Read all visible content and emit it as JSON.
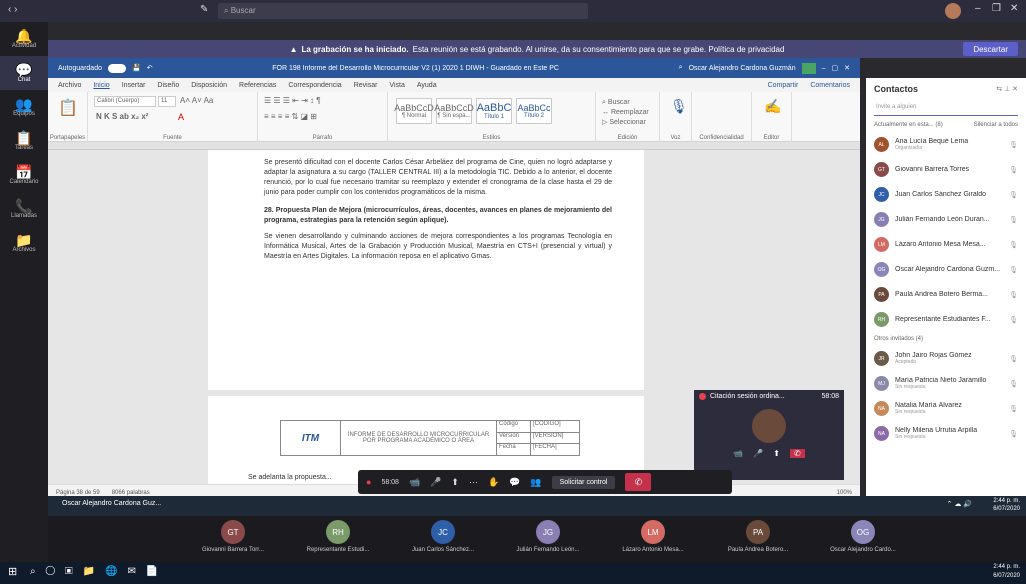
{
  "search_placeholder": "Buscar",
  "banner": {
    "bold": "La grabación se ha iniciado.",
    "text": "Esta reunión se está grabando. Al unirse, da su consentimiento para que se grabe. Política de privacidad",
    "discard": "Descartar"
  },
  "word": {
    "autosave": "Autoguardado",
    "title": "FOR 198 Informe del Desarrollo Microcurricular V2 (1) 2020 1 DIWH - Guardado en Este PC",
    "user": "Oscar Alejandro Cardona Guzmán",
    "tabs": [
      "Archivo",
      "Inicio",
      "Insertar",
      "Diseño",
      "Disposición",
      "Referencias",
      "Correspondencia",
      "Revisar",
      "Vista",
      "Ayuda"
    ],
    "share": "Compartir",
    "comments": "Comentarios",
    "groups": [
      "Portapapeles",
      "Fuente",
      "Párrafo",
      "Estilos",
      "Edición",
      "Voz",
      "Confidencialidad",
      "Editor"
    ],
    "font": "Calibri (Cuerpo)",
    "size": "11",
    "styles": [
      "¶ Normal",
      "¶ Sin espa...",
      "Título 1",
      "Título 2"
    ],
    "para1": "Se presentó dificultad con el docente Carlos César Arbeláez del programa de Cine, quien no logró adaptarse y adaptar la asignatura a su cargo (TALLER CENTRAL III) a la metodología TIC. Debido a lo anterior, el docente renunció, por lo cual fue necesario tramitar su reemplazo y extender el cronograma de la clase hasta el 29 de junio para poder cumplir con los contenidos programáticos de la misma.",
    "heading": "28. Propuesta Plan de Mejora (microcurrículos, áreas, docentes, avances en planes de mejoramiento del programa, estrategias para la retención según aplique).",
    "para2": "Se vienen desarrollando y culminando acciones de mejora correspondientes a los programas Tecnología en Informática Musical, Artes de la Grabación y Producción Musical, Maestría en CTS+I (presencial y virtual) y Maestría en Artes Digitales. La información reposa en el aplicativo Gmas.",
    "hdr_title": "INFORME DE DESARROLLO MICROCURRICULAR POR PROGRAMA ACADÉMICO O ÁREA",
    "hdr_logo": "ITM",
    "hdr_rows": [
      [
        "Código",
        "[CODIGO]"
      ],
      [
        "Versión",
        "[VERSION]"
      ],
      [
        "Fecha",
        "[FECHA]"
      ]
    ],
    "para3": "Se adelanta la propuesta...",
    "status_pages": "Página 38 de 59",
    "status_words": "8066 palabras",
    "zoom": "100%"
  },
  "contacts": {
    "title": "Contactos",
    "invite": "Invite a alguien",
    "active": "Actualmente en esta... (8)",
    "silence": "Silenciar a todos",
    "people": [
      {
        "initials": "AL",
        "name": "Ana Lucía Bequé Lema",
        "sub": "Organizador",
        "color": "#a0522d"
      },
      {
        "initials": "GT",
        "name": "Giovanni Barrera Torres",
        "sub": "",
        "color": "#8b4a4a"
      },
      {
        "initials": "JC",
        "name": "Juan Carlos Sánchez Giraldo",
        "sub": "",
        "color": "#2e5fa8"
      },
      {
        "initials": "JG",
        "name": "Julián Fernando León Duran...",
        "sub": "",
        "color": "#8a7fb3"
      },
      {
        "initials": "LM",
        "name": "Lázaro Antonio Mesa Mesa...",
        "sub": "",
        "color": "#d36a63"
      },
      {
        "initials": "OG",
        "name": "Oscar Alejandro Cardona Guzm...",
        "sub": "",
        "color": "#8a86b8"
      },
      {
        "initials": "PA",
        "name": "Paula Andrea Botero Berma...",
        "sub": "",
        "color": "#6a4a3a"
      },
      {
        "initials": "RH",
        "name": "Representante Estudiantes F...",
        "sub": "",
        "color": "#7a9a6a"
      }
    ],
    "others": "Otros invitados (4)",
    "invited": [
      {
        "initials": "JR",
        "name": "John Jairo Rojas Gómez",
        "sub": "Aceptado",
        "color": "#6a5a4a"
      },
      {
        "initials": "MJ",
        "name": "María Patricia Nieto Jaramillo",
        "sub": "Sin respuesta",
        "color": "#8a8aa8"
      },
      {
        "initials": "NA",
        "name": "Natalia María Álvarez",
        "sub": "Sin respuesta",
        "color": "#c48a5a"
      },
      {
        "initials": "NA",
        "name": "Nelly Milena Urrutia Arpilla",
        "sub": "Sin respuesta",
        "color": "#8a6aa8"
      }
    ]
  },
  "controls": {
    "timer": "58:08",
    "request": "Solicitar control"
  },
  "popup": {
    "title": "Citación sesión ordina...",
    "time": "58:08"
  },
  "winbar": {
    "presenter": "Oscar Alejandro Cardona Guz..."
  },
  "participants": [
    {
      "initials": "GT",
      "name": "Giovanni Barrera Torr...",
      "color": "#8b4a4a"
    },
    {
      "initials": "RH",
      "name": "Representante Estudi...",
      "color": "#7a9a6a"
    },
    {
      "initials": "JC",
      "name": "Juan Carlos Sánchez...",
      "color": "#2e5fa8"
    },
    {
      "initials": "JG",
      "name": "Julián Fernando León...",
      "color": "#8a7fb3"
    },
    {
      "initials": "LM",
      "name": "Lázaro Antonio Mesa...",
      "color": "#d36a63"
    },
    {
      "initials": "PA",
      "name": "Paula Andrea Botero...",
      "color": "#6a4a3a"
    },
    {
      "initials": "OG",
      "name": "Oscar Alejandro Cardo...",
      "color": "#8a86b8"
    }
  ],
  "clock": {
    "time": "2:44 p. m.",
    "date": "6/07/2020"
  },
  "rail": [
    {
      "icon": "bell-icon",
      "glyph": "🔔",
      "label": "Actividad"
    },
    {
      "icon": "chat-icon",
      "glyph": "💬",
      "label": "Chat"
    },
    {
      "icon": "teams-icon",
      "glyph": "👥",
      "label": "Equipos"
    },
    {
      "icon": "assignments-icon",
      "glyph": "📋",
      "label": "Tareas"
    },
    {
      "icon": "calendar-icon",
      "glyph": "📅",
      "label": "Calendario"
    },
    {
      "icon": "calls-icon",
      "glyph": "📞",
      "label": "Llamadas"
    },
    {
      "icon": "files-icon",
      "glyph": "📁",
      "label": "Archivos"
    }
  ]
}
